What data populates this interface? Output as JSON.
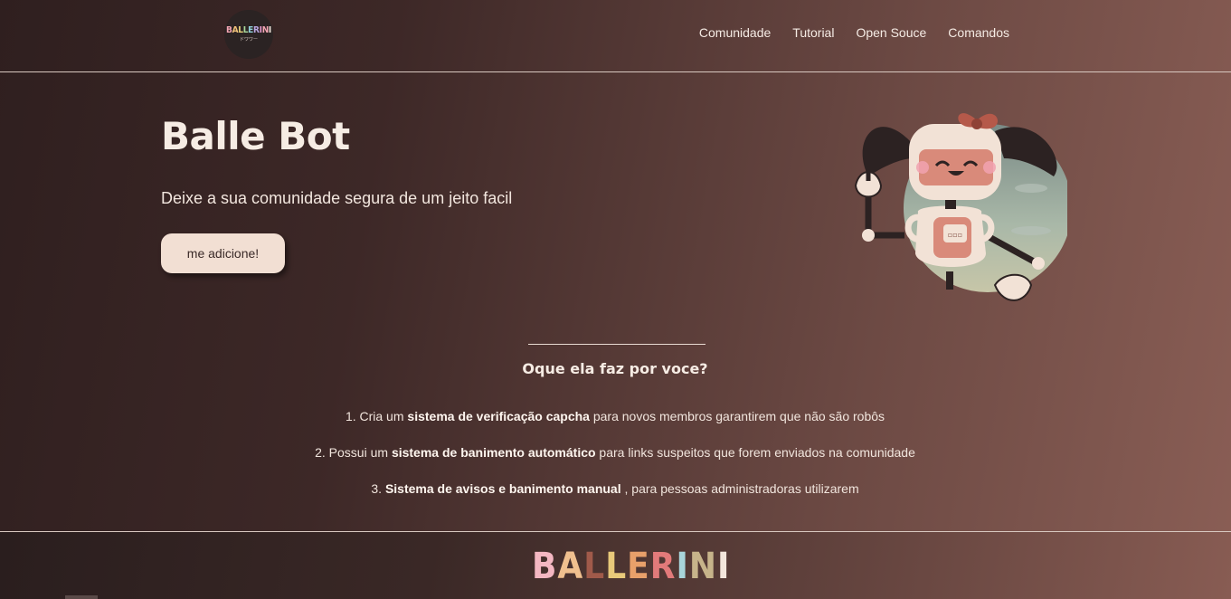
{
  "header": {
    "logo_text": "BALLERINI",
    "logo_sub": "ドワワー",
    "nav": [
      {
        "label": "Comunidade"
      },
      {
        "label": "Tutorial"
      },
      {
        "label": "Open Souce"
      },
      {
        "label": "Comandos"
      }
    ]
  },
  "hero": {
    "title": "Balle Bot",
    "subtitle": "Deixe a sua comunidade segura de um jeito facil",
    "cta_label": "me adicione!"
  },
  "features": {
    "title": "Oque ela faz por voce?",
    "items": [
      {
        "prefix": "1. Cria um ",
        "bold": "sistema de verificação capcha",
        "suffix": " para novos membros garantirem que não são robôs"
      },
      {
        "prefix": "2. Possui um ",
        "bold": "sistema de banimento automático",
        "suffix": " para links suspeitos que forem enviados na comunidade"
      },
      {
        "prefix": "3. ",
        "bold": "Sistema de avisos e banimento manual",
        "suffix": " , para pessoas administradoras utilizarem"
      }
    ]
  },
  "footer": {
    "logo_text": "BALLERINI"
  },
  "colors": {
    "accent_button": "#f2dfd3",
    "text_light": "#f6ece4"
  },
  "icons": {
    "logo": "ballerini-logo-icon",
    "mascot": "robot-mascot-illustration"
  }
}
